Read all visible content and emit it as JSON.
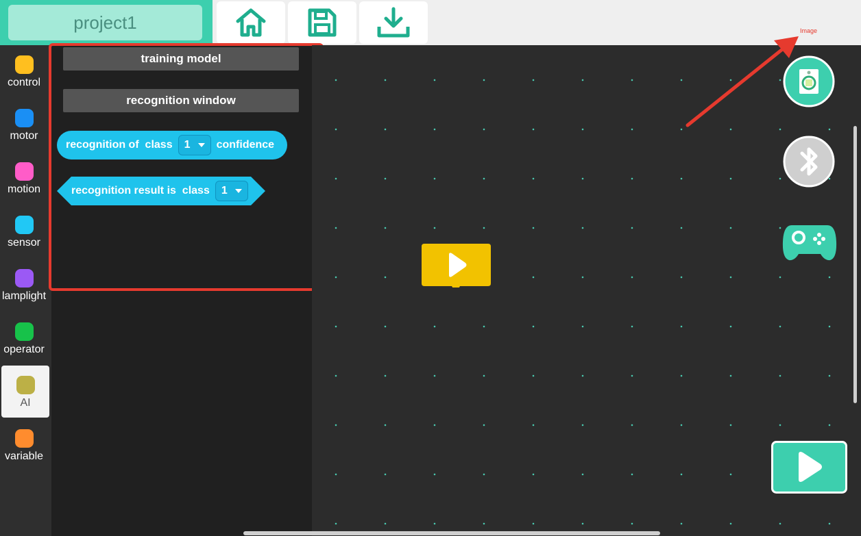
{
  "header": {
    "project_name": "project1",
    "toolbar": {
      "home_icon": "home-icon",
      "save_icon": "save-icon",
      "download_icon": "download-icon"
    }
  },
  "sidebar": {
    "categories": [
      {
        "label": "control",
        "color": "#ffbf1f"
      },
      {
        "label": "motor",
        "color": "#1a8ff5"
      },
      {
        "label": "motion",
        "color": "#ff5cc8"
      },
      {
        "label": "sensor",
        "color": "#21c8f5"
      },
      {
        "label": "lamplight",
        "color": "#9b59f5"
      },
      {
        "label": "operator",
        "color": "#17c24a"
      },
      {
        "label": "AI",
        "color": "#bcb046",
        "selected": true
      },
      {
        "label": "variable",
        "color": "#ff8c2e"
      }
    ]
  },
  "palette": {
    "blocks": {
      "training_model": "training model",
      "recognition_window": "recognition window",
      "recognition_confidence": {
        "prefix": "recognition of  class",
        "value": "1",
        "suffix": "confidence"
      },
      "recognition_result": {
        "prefix": "recognition result is  class",
        "value": "1"
      }
    }
  },
  "annotation": {
    "label": "Image"
  },
  "colors": {
    "accent": "#3dcfae",
    "block_blue": "#1fc3ec",
    "start_yellow": "#f2c200",
    "highlight_red": "#e63a2e"
  }
}
